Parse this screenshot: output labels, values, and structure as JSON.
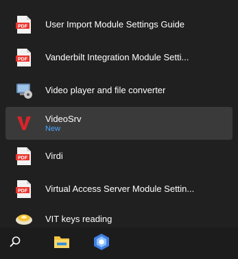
{
  "start_menu": {
    "items": [
      {
        "label": "User Import Module Settings Guide",
        "icon": "pdf-icon",
        "sub": ""
      },
      {
        "label": "Vanderbilt Integration Module Setti...",
        "icon": "pdf-icon",
        "sub": ""
      },
      {
        "label": "Video player and file converter",
        "icon": "video-converter-icon",
        "sub": ""
      },
      {
        "label": "VideoSrv",
        "icon": "videosrv-icon",
        "sub": "New",
        "selected": true
      },
      {
        "label": "Virdi",
        "icon": "pdf-icon",
        "sub": ""
      },
      {
        "label": "Virtual Access Server Module Settin...",
        "icon": "pdf-icon",
        "sub": ""
      },
      {
        "label": "VIT keys reading",
        "icon": "vit-keys-icon",
        "sub": ""
      }
    ]
  },
  "taskbar": {
    "buttons": [
      "search-icon",
      "file-explorer-icon",
      "app-hexagon-icon"
    ]
  },
  "colors": {
    "background": "#202020",
    "selected": "#3a3a3a",
    "new_badge": "#4aa3ff",
    "pdf_red": "#e8352e"
  }
}
